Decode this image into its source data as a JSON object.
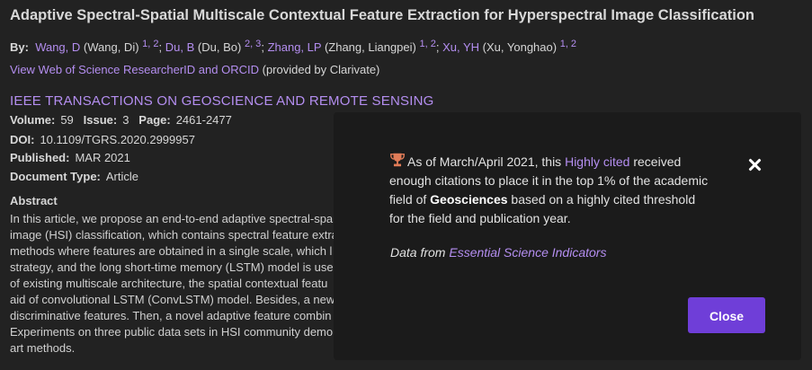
{
  "record": {
    "title": "Adaptive Spectral-Spatial Multiscale Contextual Feature Extraction for Hyperspectral Image Classification",
    "by_label": "By:",
    "authors": [
      {
        "short": "Wang, D",
        "full": "(Wang, Di)",
        "sup": "1, 2",
        "sep": ";"
      },
      {
        "short": "Du, B",
        "full": "(Du, Bo)",
        "sup": "2, 3",
        "sep": ";"
      },
      {
        "short": "Zhang, LP",
        "full": "(Zhang, Liangpei)",
        "sup": "1, 2",
        "sep": ";"
      },
      {
        "short": "Xu, YH",
        "full": "(Xu, Yonghao)",
        "sup": "1, 2",
        "sep": ""
      }
    ],
    "researcher_link": "View Web of Science ResearcherID and ORCID",
    "researcher_note": "(provided by Clarivate)",
    "journal": "IEEE TRANSACTIONS ON GEOSCIENCE AND REMOTE SENSING",
    "volume_label": "Volume:",
    "volume": "59",
    "issue_label": "Issue:",
    "issue": "3",
    "page_label": "Page:",
    "pages": "2461-2477",
    "doi_label": "DOI:",
    "doi": "10.1109/TGRS.2020.2999957",
    "published_label": "Published:",
    "published": "MAR 2021",
    "doctype_label": "Document Type:",
    "doctype": "Article",
    "abstract_label": "Abstract",
    "abstract_lines": [
      "In this article, we propose an end-to-end adaptive spectral-spa",
      "image (HSI) classification, which contains spectral feature extra",
      "methods where features are obtained in a single scale, which l",
      "strategy, and the long short-time memory (LSTM) model is use",
      "of existing multiscale architecture, the spatial contextual featu",
      "aid of convolutional LSTM (ConvLSTM) model. Besides, a new s",
      "discriminative features. Then, a novel adaptive feature combin",
      "Experiments on three public data sets in HSI community demo",
      "art methods."
    ]
  },
  "dialog": {
    "text_before": "As of March/April 2021, this ",
    "highly_cited": "Highly cited",
    "text_mid": " received enough citations to place it in the top 1% of the academic field of ",
    "field": "Geosciences",
    "text_after": " based on a highly cited threshold for the field and publication year.",
    "source_prefix": "Data from ",
    "source_link": "Essential Science Indicators",
    "close_label": "Close",
    "icon": "trophy-icon",
    "accent": "#6f3ed8",
    "link_color": "#b48ef0"
  }
}
